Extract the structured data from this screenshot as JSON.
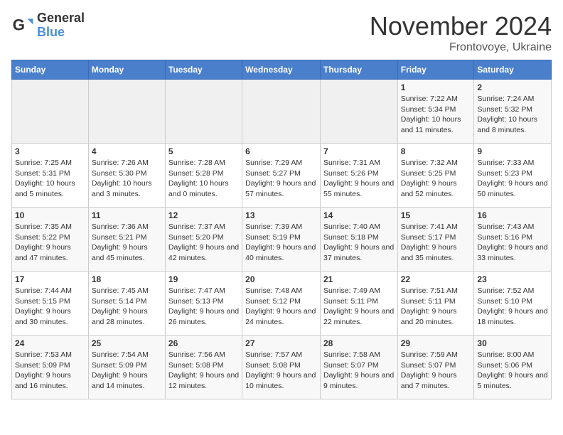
{
  "header": {
    "logo_general": "General",
    "logo_blue": "Blue",
    "month_title": "November 2024",
    "location": "Frontovoye, Ukraine"
  },
  "weekdays": [
    "Sunday",
    "Monday",
    "Tuesday",
    "Wednesday",
    "Thursday",
    "Friday",
    "Saturday"
  ],
  "weeks": [
    [
      {
        "day": "",
        "info": ""
      },
      {
        "day": "",
        "info": ""
      },
      {
        "day": "",
        "info": ""
      },
      {
        "day": "",
        "info": ""
      },
      {
        "day": "",
        "info": ""
      },
      {
        "day": "1",
        "info": "Sunrise: 7:22 AM\nSunset: 5:34 PM\nDaylight: 10 hours and 11 minutes."
      },
      {
        "day": "2",
        "info": "Sunrise: 7:24 AM\nSunset: 5:32 PM\nDaylight: 10 hours and 8 minutes."
      }
    ],
    [
      {
        "day": "3",
        "info": "Sunrise: 7:25 AM\nSunset: 5:31 PM\nDaylight: 10 hours and 5 minutes."
      },
      {
        "day": "4",
        "info": "Sunrise: 7:26 AM\nSunset: 5:30 PM\nDaylight: 10 hours and 3 minutes."
      },
      {
        "day": "5",
        "info": "Sunrise: 7:28 AM\nSunset: 5:28 PM\nDaylight: 10 hours and 0 minutes."
      },
      {
        "day": "6",
        "info": "Sunrise: 7:29 AM\nSunset: 5:27 PM\nDaylight: 9 hours and 57 minutes."
      },
      {
        "day": "7",
        "info": "Sunrise: 7:31 AM\nSunset: 5:26 PM\nDaylight: 9 hours and 55 minutes."
      },
      {
        "day": "8",
        "info": "Sunrise: 7:32 AM\nSunset: 5:25 PM\nDaylight: 9 hours and 52 minutes."
      },
      {
        "day": "9",
        "info": "Sunrise: 7:33 AM\nSunset: 5:23 PM\nDaylight: 9 hours and 50 minutes."
      }
    ],
    [
      {
        "day": "10",
        "info": "Sunrise: 7:35 AM\nSunset: 5:22 PM\nDaylight: 9 hours and 47 minutes."
      },
      {
        "day": "11",
        "info": "Sunrise: 7:36 AM\nSunset: 5:21 PM\nDaylight: 9 hours and 45 minutes."
      },
      {
        "day": "12",
        "info": "Sunrise: 7:37 AM\nSunset: 5:20 PM\nDaylight: 9 hours and 42 minutes."
      },
      {
        "day": "13",
        "info": "Sunrise: 7:39 AM\nSunset: 5:19 PM\nDaylight: 9 hours and 40 minutes."
      },
      {
        "day": "14",
        "info": "Sunrise: 7:40 AM\nSunset: 5:18 PM\nDaylight: 9 hours and 37 minutes."
      },
      {
        "day": "15",
        "info": "Sunrise: 7:41 AM\nSunset: 5:17 PM\nDaylight: 9 hours and 35 minutes."
      },
      {
        "day": "16",
        "info": "Sunrise: 7:43 AM\nSunset: 5:16 PM\nDaylight: 9 hours and 33 minutes."
      }
    ],
    [
      {
        "day": "17",
        "info": "Sunrise: 7:44 AM\nSunset: 5:15 PM\nDaylight: 9 hours and 30 minutes."
      },
      {
        "day": "18",
        "info": "Sunrise: 7:45 AM\nSunset: 5:14 PM\nDaylight: 9 hours and 28 minutes."
      },
      {
        "day": "19",
        "info": "Sunrise: 7:47 AM\nSunset: 5:13 PM\nDaylight: 9 hours and 26 minutes."
      },
      {
        "day": "20",
        "info": "Sunrise: 7:48 AM\nSunset: 5:12 PM\nDaylight: 9 hours and 24 minutes."
      },
      {
        "day": "21",
        "info": "Sunrise: 7:49 AM\nSunset: 5:11 PM\nDaylight: 9 hours and 22 minutes."
      },
      {
        "day": "22",
        "info": "Sunrise: 7:51 AM\nSunset: 5:11 PM\nDaylight: 9 hours and 20 minutes."
      },
      {
        "day": "23",
        "info": "Sunrise: 7:52 AM\nSunset: 5:10 PM\nDaylight: 9 hours and 18 minutes."
      }
    ],
    [
      {
        "day": "24",
        "info": "Sunrise: 7:53 AM\nSunset: 5:09 PM\nDaylight: 9 hours and 16 minutes."
      },
      {
        "day": "25",
        "info": "Sunrise: 7:54 AM\nSunset: 5:09 PM\nDaylight: 9 hours and 14 minutes."
      },
      {
        "day": "26",
        "info": "Sunrise: 7:56 AM\nSunset: 5:08 PM\nDaylight: 9 hours and 12 minutes."
      },
      {
        "day": "27",
        "info": "Sunrise: 7:57 AM\nSunset: 5:08 PM\nDaylight: 9 hours and 10 minutes."
      },
      {
        "day": "28",
        "info": "Sunrise: 7:58 AM\nSunset: 5:07 PM\nDaylight: 9 hours and 9 minutes."
      },
      {
        "day": "29",
        "info": "Sunrise: 7:59 AM\nSunset: 5:07 PM\nDaylight: 9 hours and 7 minutes."
      },
      {
        "day": "30",
        "info": "Sunrise: 8:00 AM\nSunset: 5:06 PM\nDaylight: 9 hours and 5 minutes."
      }
    ]
  ]
}
